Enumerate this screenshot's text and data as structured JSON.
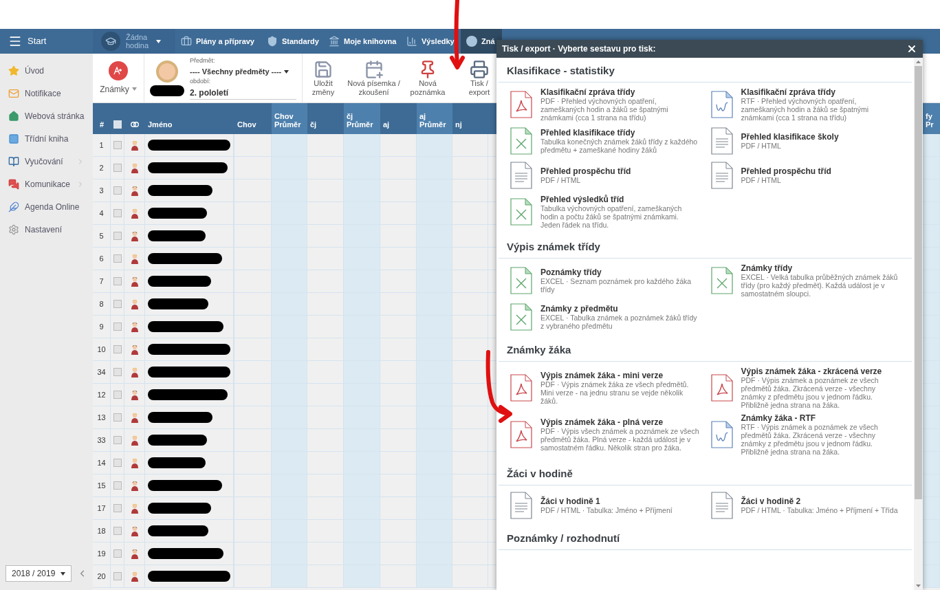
{
  "nav": {
    "start_label": "Start",
    "lesson": {
      "label": "Žádna hodina"
    },
    "tabs": [
      {
        "label": "Plány a přípravy",
        "selected": false
      },
      {
        "label": "Standardy",
        "selected": false
      },
      {
        "label": "Moje knihovna",
        "selected": false
      },
      {
        "label": "Výsledky",
        "selected": false
      },
      {
        "label": "Zná",
        "selected": true
      }
    ]
  },
  "sidebar": {
    "items": [
      {
        "label": "Úvod",
        "has_submenu": false
      },
      {
        "label": "Notifikace",
        "has_submenu": false
      },
      {
        "label": "Webová stránka",
        "has_submenu": false
      },
      {
        "label": "Třídní kniha",
        "has_submenu": false
      },
      {
        "label": "Vyučování",
        "has_submenu": true
      },
      {
        "label": "Komunikace",
        "has_submenu": true
      },
      {
        "label": "Agenda Online",
        "has_submenu": false
      },
      {
        "label": "Nastavení",
        "has_submenu": false
      }
    ],
    "year": "2018 / 2019"
  },
  "toolbar": {
    "mode": "Známky",
    "subject_label": "Předmět:",
    "subject": "---- Všechny předměty ----",
    "period_label": "období:",
    "period": "2. pololetí",
    "buttons": [
      {
        "label": "Uložit změny"
      },
      {
        "label": "Nová písemka / zkoušení"
      },
      {
        "label": "Nová poznámka"
      },
      {
        "label": "Tisk / export"
      }
    ]
  },
  "table": {
    "all_checked": false,
    "columns": [
      {
        "label": "#",
        "kind": "number"
      },
      {
        "kind": "check"
      },
      {
        "kind": "gender"
      },
      {
        "label": "Jméno",
        "kind": "name"
      },
      {
        "label": "Chov",
        "kind": "plain"
      },
      {
        "label": "Chov Průměr",
        "kind": "average"
      },
      {
        "label": "čj",
        "kind": "plain"
      },
      {
        "label": "čj Průměr",
        "kind": "average"
      },
      {
        "label": "aj",
        "kind": "plain"
      },
      {
        "label": "aj Průměr",
        "kind": "average"
      },
      {
        "label": "nj",
        "kind": "plain"
      },
      {
        "label": "fy Pr",
        "kind": "average"
      }
    ],
    "rows": [
      {
        "number": "1",
        "checked": false,
        "kind": "female"
      },
      {
        "number": "2",
        "checked": false,
        "kind": "female"
      },
      {
        "number": "3",
        "checked": false,
        "kind": "male"
      },
      {
        "number": "4",
        "checked": false,
        "kind": "female"
      },
      {
        "number": "5",
        "checked": false,
        "kind": "male"
      },
      {
        "number": "6",
        "checked": false,
        "kind": "female"
      },
      {
        "number": "7",
        "checked": false,
        "kind": "male"
      },
      {
        "number": "8",
        "checked": false,
        "kind": "female"
      },
      {
        "number": "9",
        "checked": false,
        "kind": "male"
      },
      {
        "number": "10",
        "checked": false,
        "kind": "male"
      },
      {
        "number": "34",
        "checked": false,
        "kind": "female"
      },
      {
        "number": "12",
        "checked": false,
        "kind": "male"
      },
      {
        "number": "13",
        "checked": false,
        "kind": "female"
      },
      {
        "number": "33",
        "checked": false,
        "kind": "female"
      },
      {
        "number": "14",
        "checked": false,
        "kind": "female"
      },
      {
        "number": "15",
        "checked": false,
        "kind": "male"
      },
      {
        "number": "17",
        "checked": false,
        "kind": "female"
      },
      {
        "number": "18",
        "checked": false,
        "kind": "male"
      },
      {
        "number": "19",
        "checked": false,
        "kind": "male"
      },
      {
        "number": "20",
        "checked": false,
        "kind": "female"
      }
    ]
  },
  "dialog": {
    "title": "Tisk / export · Vyberte sestavu pro tisk:",
    "sections": [
      {
        "heading": "Klasifikace - statistiky",
        "items": [
          {
            "kind": "pdf",
            "title": "Klasifikační zpráva třídy",
            "description": "PDF · Přehled výchovných opatření, zameškaných hodin a žáků se špatnými známkami (cca 1 strana na třídu)"
          },
          {
            "kind": "rtf",
            "title": "Klasifikační zpráva třídy",
            "description": "RTF · Přehled výchovných opatření, zameškaných hodin a žáků se špatnými známkami (cca 1 strana na třídu)"
          },
          {
            "kind": "excel",
            "title": "Přehled klasifikace třídy",
            "description": "Tabulka konečných známek žáků třídy z každého předmětu + zameškané hodiny žáků"
          },
          {
            "kind": "doc",
            "title": "Přehled klasifikace školy",
            "description": "PDF / HTML"
          },
          {
            "kind": "doc",
            "title": "Přehled prospěchu tříd",
            "description": "PDF / HTML"
          },
          {
            "kind": "doc",
            "title": "Přehled prospěchu tříd",
            "description": "PDF / HTML"
          },
          {
            "kind": "excel",
            "title": "Přehled výsledků tříd",
            "description": "Tabulka výchovných opatření, zameškaných hodin a počtu žáků se špatnými známkami. Jeden řádek na třídu."
          }
        ]
      },
      {
        "heading": "Výpis známek třídy",
        "items": [
          {
            "kind": "excel",
            "title": "Poznámky třídy",
            "description": "EXCEL · Seznam poznámek pro každého žáka třídy"
          },
          {
            "kind": "excel",
            "title": "Známky třídy",
            "description": "EXCEL · Velká tabulka průběžných známek žáků třídy (pro každý předmět). Každá událost je v samostatném sloupci."
          },
          {
            "kind": "excel",
            "title": "Známky z předmětu",
            "description": "EXCEL · Tabulka známek a poznámek žáků třídy z vybraného předmětu"
          }
        ]
      },
      {
        "heading": "Známky žáka",
        "items": [
          {
            "kind": "pdf",
            "title": "Výpis známek žáka - mini verze",
            "description": "PDF · Výpis známek žáka ze všech předmětů. Mini verze - na jednu stranu se vejde několik žáků."
          },
          {
            "kind": "pdf",
            "title": "Výpis známek žáka - zkrácená verze",
            "description": "PDF · Výpis známek a poznámek ze všech předmětů žáka. Zkrácená verze - všechny známky z předmětu jsou v jednom řádku. Přibližně jedna strana na žáka."
          },
          {
            "kind": "pdf",
            "title": "Výpis známek žáka - plná verze",
            "description": "PDF · Výpis všech známek a poznámek ze všech předmětů žáka. Plná verze - každá událost je v samostatném řádku. Několik stran pro žáka."
          },
          {
            "kind": "rtf",
            "title": "Známky žáka - RTF",
            "description": "RTF · Výpis známek a poznámek ze všech předmětů žáka. Zkrácená verze - všechny známky z předmětu jsou v jednom řádku. Přibližně jedna strana na žáka."
          }
        ]
      },
      {
        "heading": "Žáci v hodině",
        "items": [
          {
            "kind": "doc",
            "title": "Žáci v hodině 1",
            "description": "PDF / HTML · Tabulka: Jméno + Příjmení"
          },
          {
            "kind": "doc",
            "title": "Žáci v hodině 2",
            "description": "PDF / HTML · Tabulka: Jméno + Příjmení + Třída"
          }
        ]
      },
      {
        "heading": "Poznámky / rozhodnutí"
      }
    ]
  }
}
